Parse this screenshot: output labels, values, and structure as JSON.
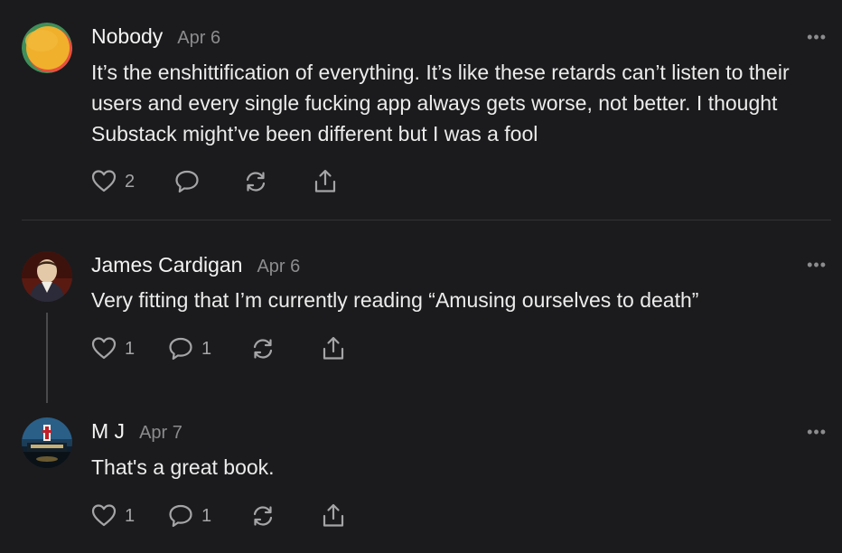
{
  "comments": [
    {
      "author": "Nobody",
      "date": "Apr 6",
      "text": "It’s the enshittification of everything. It’s like these retards can’t listen to their users and every single fucking app always gets worse, not better. I thought Substack might’ve been different but I was a fool",
      "likes": "2",
      "replies": "",
      "more": "•••",
      "avatar_icon": "gradient-orb-avatar"
    },
    {
      "author": "James Cardigan",
      "date": "Apr 6",
      "text": "Very fitting that I’m currently reading “Amusing ourselves to death”",
      "likes": "1",
      "replies": "1",
      "more": "•••",
      "avatar_icon": "portrait-avatar"
    },
    {
      "author": "M J",
      "date": "Apr 7",
      "text": "That's a great book.",
      "likes": "1",
      "replies": "1",
      "more": "•••",
      "avatar_icon": "church-night-avatar"
    }
  ],
  "colors": {
    "background": "#1b1b1d",
    "text": "#ececec",
    "muted": "#8c8c8e",
    "icon": "#a5a5a7"
  }
}
